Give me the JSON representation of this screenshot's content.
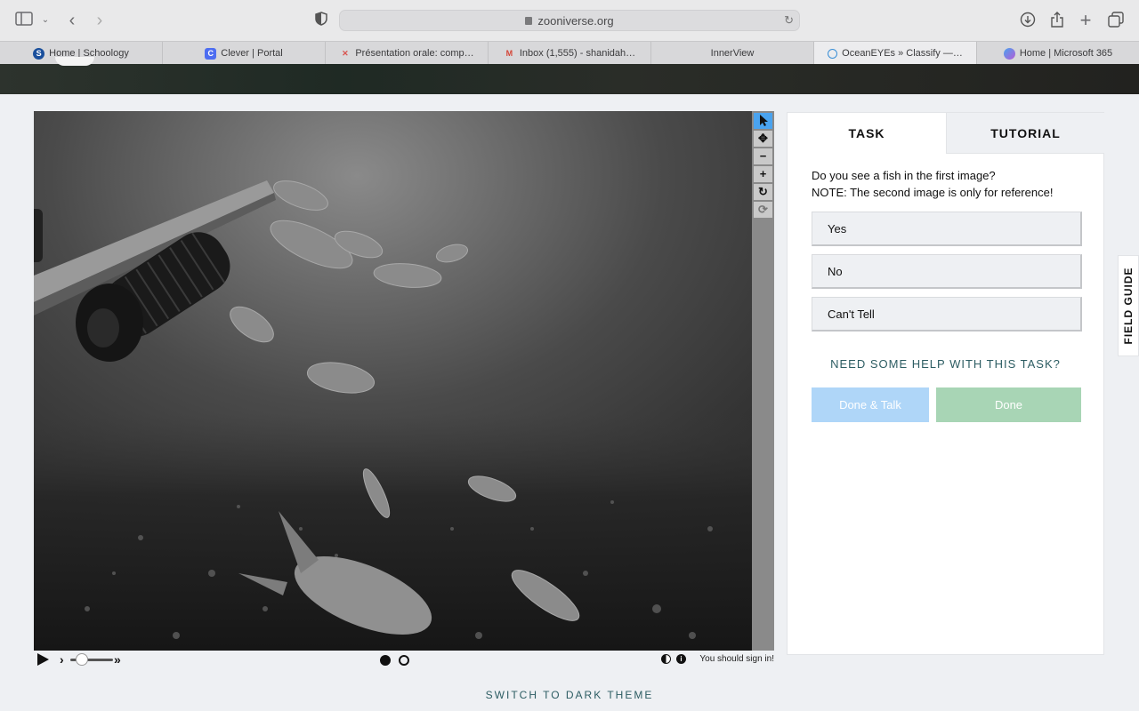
{
  "browser": {
    "url": "zooniverse.org",
    "tabs": [
      {
        "label": "Home | Schoology",
        "icon": "schoology-icon",
        "color": "#1a4f9c"
      },
      {
        "label": "Clever | Portal",
        "icon": "clever-icon",
        "color": "#4d6df1"
      },
      {
        "label": "Présentation orale: comp…",
        "icon": "presentation-icon",
        "color": "#d9534f"
      },
      {
        "label": "Inbox (1,555) - shanidah…",
        "icon": "gmail-icon",
        "color": "#d44638"
      },
      {
        "label": "InnerView",
        "icon": "",
        "color": ""
      },
      {
        "label": "OceanEYEs » Classify —…",
        "icon": "zooniverse-icon",
        "color": "#3a8fd6"
      },
      {
        "label": "Home | Microsoft 365",
        "icon": "microsoft365-icon",
        "color": "#7a5cd6"
      }
    ],
    "active_tab_index": 5
  },
  "viewer": {
    "tools": [
      "pointer-icon",
      "move-icon",
      "zoom-out-icon",
      "zoom-in-icon",
      "rotate-icon",
      "reset-icon"
    ],
    "active_tool": "pointer-icon",
    "frame_count": 2,
    "current_frame": 1,
    "signin_text": "You should sign in!"
  },
  "task": {
    "tabs": [
      "TASK",
      "TUTORIAL"
    ],
    "active_tab": "TASK",
    "question_line1": "Do you see a fish in the first image?",
    "question_line2": "NOTE: The second image is only for reference!",
    "answers": [
      "Yes",
      "No",
      "Can't Tell"
    ],
    "help_text": "NEED SOME HELP WITH THIS TASK?",
    "done_talk_label": "Done & Talk",
    "done_label": "Done",
    "done_talk_color": "#afd6f8",
    "done_color": "#a8d5b5"
  },
  "field_guide_label": "FIELD GUIDE",
  "footer": {
    "dark_theme_label": "SWITCH TO DARK THEME"
  }
}
